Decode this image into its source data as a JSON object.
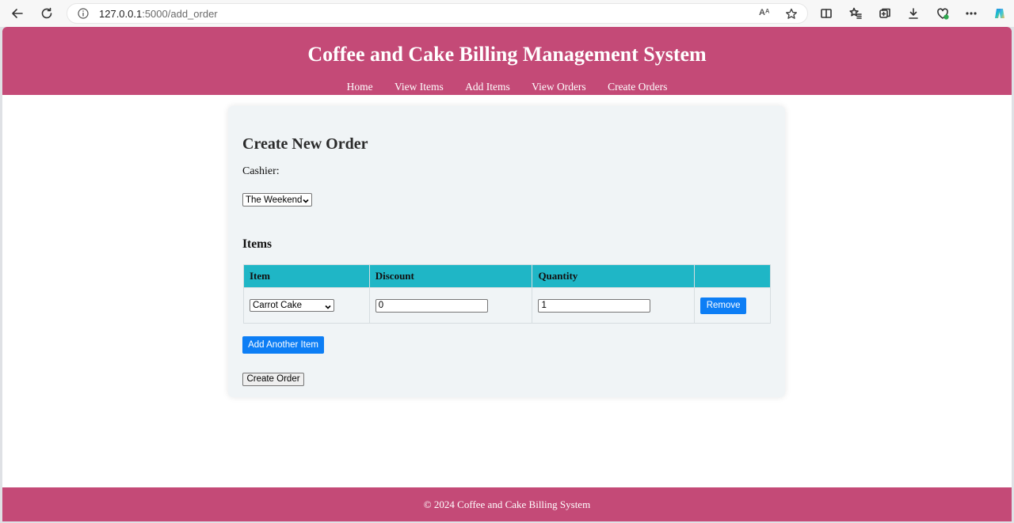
{
  "browser": {
    "url_host": "127.0.0.1",
    "url_rest": ":5000/add_order",
    "read_aloud": "Aᴬ"
  },
  "header": {
    "title": "Coffee and Cake Billing Management System",
    "nav": [
      "Home",
      "View Items",
      "Add Items",
      "View Orders",
      "Create Orders"
    ]
  },
  "form": {
    "heading": "Create New Order",
    "cashier_label": "Cashier:",
    "cashier_selected": "The Weekend",
    "items_heading": "Items",
    "columns": [
      "Item",
      "Discount",
      "Quantity",
      ""
    ],
    "rows": [
      {
        "item": "Carrot Cake",
        "discount": "0",
        "quantity": "1",
        "remove_label": "Remove"
      }
    ],
    "add_item_label": "Add Another Item",
    "submit_label": "Create Order"
  },
  "footer": {
    "text": "© 2024 Coffee and Cake Billing System"
  },
  "colors": {
    "brand": "#c44a77",
    "table_header": "#1fb6c6",
    "button_blue": "#0d7ef5"
  }
}
